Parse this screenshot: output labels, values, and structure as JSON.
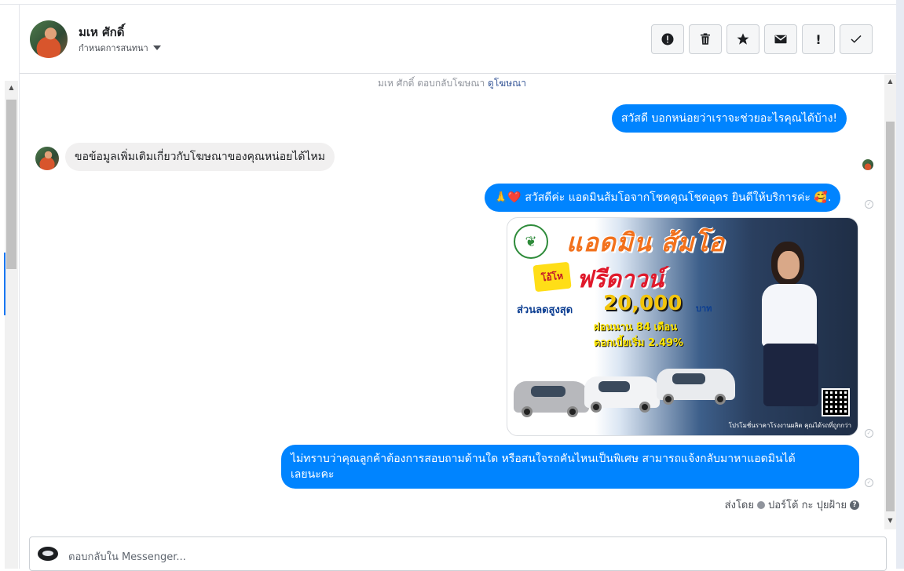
{
  "header": {
    "contact_name": "มเห ศักดิ์",
    "assign_label": "กำหนดการสนทนา",
    "actions": [
      {
        "name": "spam",
        "icon": "alert-circle-icon"
      },
      {
        "name": "delete",
        "icon": "trash-icon"
      },
      {
        "name": "star",
        "icon": "star-icon"
      },
      {
        "name": "mark-unread",
        "icon": "envelope-icon"
      },
      {
        "name": "follow-up",
        "label": "!"
      },
      {
        "name": "done",
        "icon": "check-icon"
      }
    ]
  },
  "ad_reply": {
    "text": "มเห ศักดิ์ ตอบกลับโฆษณา",
    "link": "ดูโฆษณา"
  },
  "messages": {
    "m1": "สวัสดี บอกหน่อยว่าเราจะช่วยอะไรคุณได้บ้าง!",
    "m2": "ขอข้อมูลเพิ่มเติมเกี่ยวกับโฆษณาของคุณหน่อยได้ไหม",
    "m3": "🙏❤️ สวัสดีค่ะ แอดมินส้มโอจากโชคคูณโชคอุดร ยินดีให้บริการค่ะ 🥰.",
    "m4_line1": "ไม่ทราบว่าคุณลูกค้าต้องการสอบถามด้านใด หรือสนใจรถคันไหนเป็นพิเศษ สามารถแจ้งกลับมาหาแอดมินได้",
    "m4_line2": "เลยนะคะ"
  },
  "ad_image": {
    "title": "แอดมิน ส้มโอ",
    "badge": "โอ้โห",
    "headline": "ฟรีดาวน์",
    "discount_label": "ส่วนลดสูงสุด",
    "discount_amount": "20,000",
    "currency": "บาท",
    "installment": "ผ่อนนาน 84 เดือน",
    "interest": "ดอกเบี้ยเริ่ม 2.49%",
    "footer": "โปรโมชั่นราคาโรงงานผลิต คุณได้รถที่ถูกกว่า"
  },
  "sent_by": {
    "label": "ส่งโดย",
    "agent": "ปอร์โต้ กะ ปุยฝ้าย",
    "help": "?"
  },
  "composer": {
    "placeholder": "ตอบกลับใน Messenger..."
  }
}
